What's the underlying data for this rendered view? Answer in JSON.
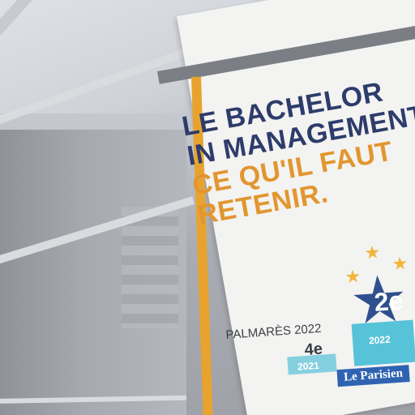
{
  "headline": {
    "line1": "LE BACHELOR",
    "line2": "IN MANAGEMENT,",
    "line3": "CE QU'IL FAUT",
    "line4": "RETENIR."
  },
  "ranking": {
    "label": "PALMARÈS 2022",
    "current_rank": "2e",
    "current_year": "2022",
    "previous_rank": "4e",
    "previous_year": "2021",
    "source_logo": "Le Parisien"
  },
  "colors": {
    "navy": "#2d3c6b",
    "orange": "#e2962f",
    "podium_blue": "#57c3d9",
    "logo_blue": "#2f63b2"
  }
}
